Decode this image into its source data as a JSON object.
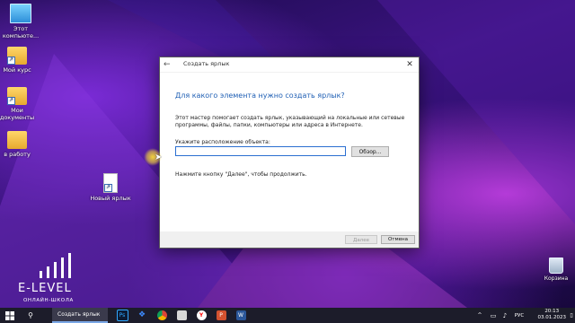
{
  "desktop": {
    "icons": [
      {
        "label": "Этот компьюте...",
        "icon": "this-pc-icon"
      },
      {
        "label": "Мой курс",
        "icon": "folder-shortcut-icon"
      },
      {
        "label": "Мои документы",
        "icon": "folder-shortcut-icon"
      },
      {
        "label": "в работу",
        "icon": "folder-icon"
      },
      {
        "label": "Новый ярлык",
        "icon": "new-shortcut-icon"
      }
    ],
    "recycle_bin": "Корзина"
  },
  "logo": {
    "main": "E-LEVEL",
    "sub": "ОНЛАЙН-ШКОЛА"
  },
  "dialog": {
    "title": "Создать ярлык",
    "heading": "Для какого элемента нужно создать ярлык?",
    "description": "Этот мастер помогает создать ярлык, указывающий на локальные или сетевые программы, файлы, папки, компьютеры или адреса в Интернете.",
    "location_label": "Укажите расположение объекта:",
    "location_value": "",
    "browse_label": "Обзор...",
    "hint": "Нажмите кнопку \"Далее\", чтобы продолжить.",
    "next_label": "Далее",
    "cancel_label": "Отмена"
  },
  "taskbar": {
    "active_task": "Создать ярлык",
    "apps": [
      "photoshop",
      "dropbox",
      "chrome",
      "files",
      "yandex",
      "powerpoint",
      "word"
    ],
    "language": "РУС",
    "time": "20:13",
    "date": "03.01.2023"
  },
  "colors": {
    "accent": "#1f5fb4",
    "taskbar": "#1c1c2a"
  }
}
